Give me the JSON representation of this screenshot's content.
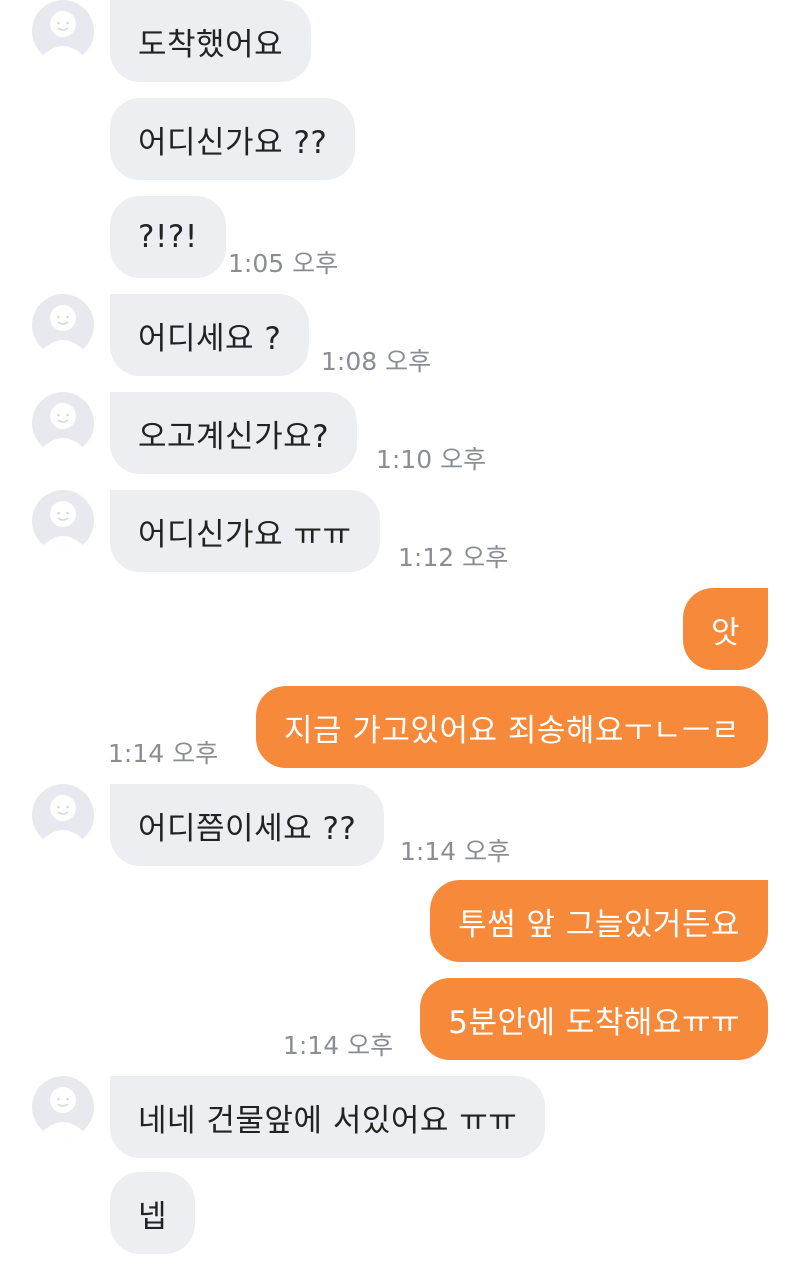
{
  "theme": {
    "incoming_bubble": "#eceef1",
    "outgoing_bubble": "#f6893a",
    "avatar_bg": "#e7e9ee"
  },
  "messages": [
    {
      "dir": "in",
      "avatar": true,
      "text": "도착했어요"
    },
    {
      "dir": "in",
      "avatar": false,
      "text": "어디신가요 ??"
    },
    {
      "dir": "in",
      "avatar": false,
      "text": "?!?!",
      "time": "1:05 오후"
    },
    {
      "dir": "in",
      "avatar": true,
      "text": "어디세요 ?",
      "time": "1:08 오후"
    },
    {
      "dir": "in",
      "avatar": true,
      "text": "오고계신가요?",
      "time": "1:10 오후"
    },
    {
      "dir": "in",
      "avatar": true,
      "text": "어디신가요 ㅠㅠ",
      "time": "1:12 오후"
    },
    {
      "dir": "out",
      "text": "앗"
    },
    {
      "dir": "out",
      "text": "지금 가고있어요 죄송해요ㅜㄴㅡㄹ",
      "time": "1:14 오후"
    },
    {
      "dir": "in",
      "avatar": true,
      "text": "어디쯤이세요 ??",
      "time": "1:14 오후"
    },
    {
      "dir": "out",
      "text": "투썸 앞 그늘있거든요"
    },
    {
      "dir": "out",
      "text": "5분안에 도착해요ㅠㅠ",
      "time": "1:14 오후"
    },
    {
      "dir": "in",
      "avatar": true,
      "text": "네네 건물앞에 서있어요 ㅠㅠ"
    },
    {
      "dir": "in",
      "avatar": false,
      "text": "넵"
    }
  ]
}
